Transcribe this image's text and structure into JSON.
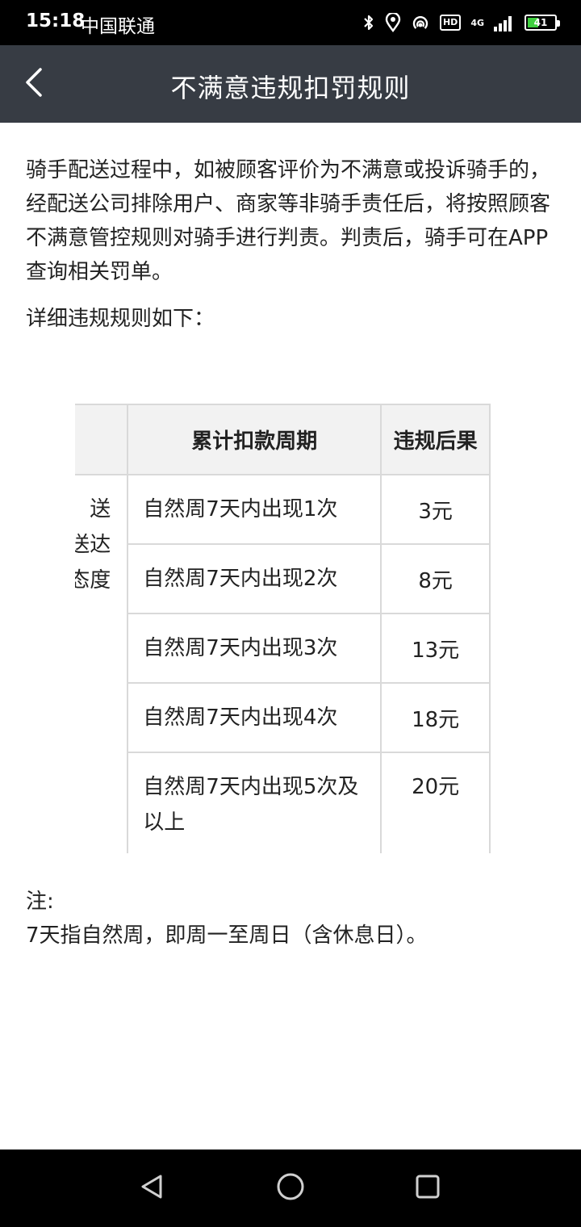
{
  "status_bar": {
    "time": "15:18",
    "carrier": "中国联通",
    "hd_label": "HD",
    "network_label": "4G",
    "battery_level": "41",
    "battery_percent": 41,
    "icons": [
      "bluetooth-icon",
      "location-icon",
      "hotspot-icon",
      "hd-badge",
      "network-4g-icon",
      "signal-icon",
      "battery-icon"
    ]
  },
  "nav": {
    "title": "不满意违规扣罚规则",
    "back_icon": "chevron-left-icon"
  },
  "content": {
    "intro": "骑手配送过程中，如被顾客评价为不满意或投诉骑手的，经配送公司排除用户、商家等非骑手责任后，将按照顾客不满意管控规则对骑手进行判责。判责后，骑手可在APP查询相关罚单。",
    "detail_title": "详细违规规则如下："
  },
  "table": {
    "headers": [
      "",
      "累计扣款周期",
      "违规后果"
    ],
    "first_col_lines": [
      "送",
      "送达",
      "态度",
      ""
    ],
    "rows": [
      {
        "cycle": "自然周7天内出现1次",
        "result": "3元"
      },
      {
        "cycle": "自然周7天内出现2次",
        "result": "8元"
      },
      {
        "cycle": "自然周7天内出现3次",
        "result": "13元"
      },
      {
        "cycle": "自然周7天内出现4次",
        "result": "18元"
      },
      {
        "cycle": "自然周7天内出现5次及以上",
        "result": "20元"
      }
    ]
  },
  "note": {
    "label": "注:",
    "text": "7天指自然周，即周一至周日（含休息日）。"
  },
  "system_nav": {
    "icons": [
      "back-triangle-icon",
      "home-circle-icon",
      "recents-square-icon"
    ]
  },
  "colors": {
    "status_bar_bg": "#000000",
    "nav_bar_bg": "#373c44",
    "table_header_bg": "#f2f2f2",
    "table_border": "#d9d9d9",
    "battery_fill": "#3fd03f"
  }
}
